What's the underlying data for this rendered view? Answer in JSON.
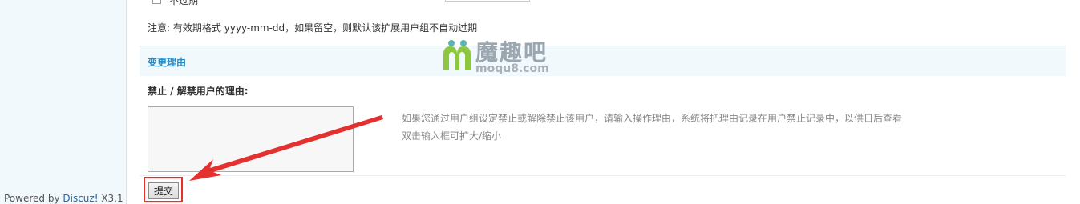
{
  "sidebar": {
    "powered_prefix": "Powered by ",
    "powered_brand": "Discuz!",
    "powered_version": " X3.1"
  },
  "form": {
    "top_checkbox_label": "不过期",
    "expiry_note": "注意: 有效期格式 yyyy-mm-dd，如果留空，则默认该扩展用户组不自动过期",
    "section_title": "变更理由",
    "reason_label": "禁止 / 解禁用户的理由:",
    "reason_value": "",
    "tip_line1": "如果您通过用户组设定禁止或解除禁止该用户，请输入操作理由，系统将把理由记录在用户禁止记录中，以供日后查看",
    "tip_line2": "双击输入框可扩大/缩小",
    "submit_label": "提交"
  },
  "watermark": {
    "name": "魔趣吧",
    "domain": "moqu8.com",
    "colors": {
      "green": "#8dc63f",
      "teal": "#5bb5b0",
      "gray": "#9aa6b0"
    }
  },
  "annotation": {
    "color": "#e53030",
    "icon": "arrow-pointing-left-down"
  }
}
